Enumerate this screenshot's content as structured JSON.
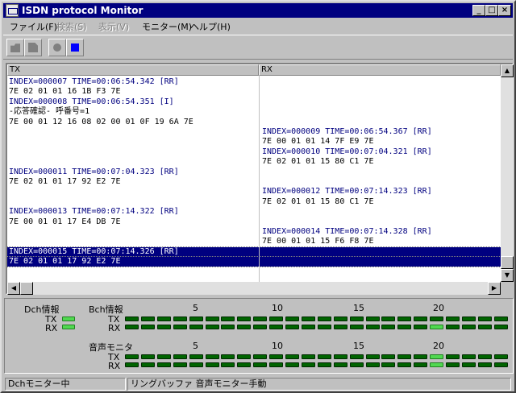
{
  "window": {
    "title": "ISDN protocol Monitor"
  },
  "menu": [
    {
      "label": "ファイル(F)",
      "enabled": true
    },
    {
      "label": "検索(S)",
      "enabled": false
    },
    {
      "label": "表示(V)",
      "enabled": false
    },
    {
      "label": "モニター(M)",
      "enabled": true
    },
    {
      "label": "ヘルプ(H)",
      "enabled": true
    }
  ],
  "toolbar": [
    {
      "icon": "open-file-icon",
      "enabled": false
    },
    {
      "icon": "save-file-icon",
      "enabled": false
    },
    {
      "icon": "record-circle-icon",
      "enabled": false
    },
    {
      "icon": "stop-square-icon",
      "enabled": true
    }
  ],
  "columns": {
    "tx": "TX",
    "rx": "RX"
  },
  "rows": [
    {
      "tx": "INDEX=000007 TIME=00:06:54.342 [RR]",
      "tx_type": "index",
      "rx": ""
    },
    {
      "tx": "7E 02 01 01 16 1B F3 7E",
      "tx_type": "data",
      "rx": ""
    },
    {
      "tx": "INDEX=000008 TIME=00:06:54.351 [I]",
      "tx_type": "index",
      "rx": ""
    },
    {
      "tx": "-応答確認- 呼番号=1",
      "tx_type": "data",
      "rx": ""
    },
    {
      "tx": "7E 00 01 12 16 08 02 00 01 0F 19 6A 7E",
      "tx_type": "data",
      "rx": ""
    },
    {
      "tx": "",
      "rx": "INDEX=000009 TIME=00:06:54.367 [RR]",
      "rx_type": "index"
    },
    {
      "tx": "",
      "rx": "7E 00 01 01 14 7F E9 7E",
      "rx_type": "data"
    },
    {
      "tx": "",
      "rx": "INDEX=000010 TIME=00:07:04.321 [RR]",
      "rx_type": "index"
    },
    {
      "tx": "",
      "rx": "7E 02 01 01 15 80 C1 7E",
      "rx_type": "data"
    },
    {
      "tx": "INDEX=000011 TIME=00:07:04.323 [RR]",
      "tx_type": "index",
      "rx": ""
    },
    {
      "tx": "7E 02 01 01 17 92 E2 7E",
      "tx_type": "data",
      "rx": ""
    },
    {
      "tx": "",
      "rx": "INDEX=000012 TIME=00:07:14.323 [RR]",
      "rx_type": "index"
    },
    {
      "tx": "",
      "rx": "7E 02 01 01 15 80 C1 7E",
      "rx_type": "data"
    },
    {
      "tx": "INDEX=000013 TIME=00:07:14.322 [RR]",
      "tx_type": "index",
      "rx": ""
    },
    {
      "tx": "7E 00 01 01 17 E4 DB 7E",
      "tx_type": "data",
      "rx": ""
    },
    {
      "tx": "",
      "rx": "INDEX=000014 TIME=00:07:14.328 [RR]",
      "rx_type": "index"
    },
    {
      "tx": "",
      "rx": "7E 00 01 01 15 F6 F8 7E",
      "rx_type": "data"
    },
    {
      "tx": "INDEX=000015 TIME=00:07:14.326 [RR]",
      "tx_type": "index",
      "rx": "",
      "selected": true
    },
    {
      "tx": "7E 02 01 01 17 92 E2 7E",
      "tx_type": "data",
      "rx": "",
      "selected": true
    }
  ],
  "monitor": {
    "dch_label": "Dch情報",
    "bch_label": "Bch情報",
    "voice_label": "音声モニタ",
    "tx_label": "TX",
    "rx_label": "RX",
    "scale": [
      "5",
      "10",
      "15",
      "20"
    ],
    "dch": {
      "tx": true,
      "rx": true
    },
    "bch_tx_active": [],
    "bch_rx_active": [
      19
    ],
    "voice_tx_active": [
      19
    ],
    "voice_rx_active": [
      19
    ],
    "channel_count": 24,
    "led_on_color": "#50d850",
    "led_off_color": "#006400"
  },
  "status": {
    "left": "Dchモニター中",
    "right": "リングバッファ 音声モニター手動"
  }
}
